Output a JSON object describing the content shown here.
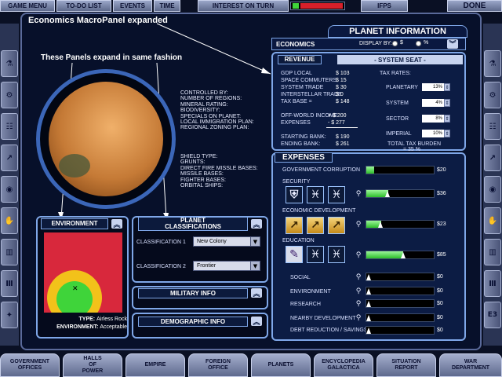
{
  "topbar": {
    "game_menu": "GAME MENU",
    "todo_list": "TO-DO LIST",
    "events": "EVENTS",
    "time": "TIME",
    "interest": "INTEREST ON TURN",
    "ifps": "IFPs",
    "done": "DONE"
  },
  "annotations": {
    "econ_expanded": "Economics MacroPanel expanded",
    "panels_expand": "These Panels expand in same fashion"
  },
  "planet_info": {
    "title": "PLANET INFORMATION",
    "economics_tab": "ECONOMICS",
    "display_by_label": "DISPLAY BY:",
    "display_dollar": "$",
    "display_percent": "%"
  },
  "planet_stats": {
    "controlled": "CONTROLLED BY:\nNUMBER OF REGIONS:\nMINERAL RATING:\nBIODIVERSITY:\nSPECIALS ON PLANET:\nLOCAL IMMIGRATION PLAN:\nREGIONAL ZONING PLAN:",
    "defense": "SHIELD TYPE:\nGRUNTS:\nDIRECT FIRE MISSLE BASES:\nMISSILE BASES:\nFIGHTER BASES:\nORBITAL SHIPS:"
  },
  "environment": {
    "title": "ENVIRONMENT",
    "type_label": "TYPE:",
    "type_value": "Airless Rock",
    "env_label": "ENVIRONMENT:",
    "env_value": "Acceptable"
  },
  "classifications": {
    "title": "PLANET\nCLASSIFICATIONS",
    "c1_label": "CLASSIFICATION 1",
    "c1_value": "New Colony",
    "c2_label": "CLASSIFICATION 2",
    "c2_value": "Frontier"
  },
  "military": {
    "title": "MILITARY INFO"
  },
  "demographic": {
    "title": "DEMOGRAPHIC INFO"
  },
  "revenue": {
    "title": "REVENUE",
    "system_seat": "- SYSTEM SEAT -",
    "gdp_label": "GDP LOCAL",
    "gdp_value": "$ 103",
    "commuters_label": "SPACE COMMUTERS",
    "commuters_value": "$ 15",
    "trade_label": "SYSTEM TRADE",
    "trade_value": "$ 30",
    "interstellar_label": "INTERSTELLAR TRADE",
    "interstellar_value": "$ 0",
    "taxbase_label": "TAX BASE =",
    "taxbase_value": "$ 148",
    "offworld_label": "OFF-WORLD INCOME",
    "offworld_value": "+ $ 200",
    "expenses_label": "EXPENSES",
    "expenses_value": "- $ 277",
    "starting_label": "STARTING BANK:",
    "starting_value": "$ 190",
    "ending_label": "ENDING BANK:",
    "ending_value": "$ 261",
    "tax_rates_label": "TAX RATES:",
    "planetary_label": "PLANETARY",
    "planetary_value": "13%",
    "system_label": "SYSTEM",
    "system_value": "4%",
    "sector_label": "SECTOR",
    "sector_value": "8%",
    "imperial_label": "IMPERIAL",
    "imperial_value": "10%",
    "burden_label": "TOTAL TAX BURDEN",
    "burden_value": "= 35 %"
  },
  "expenses": {
    "title": "EXPENSES",
    "rows": [
      {
        "label": "GOVERNMENT CORRUPTION",
        "value": "$20",
        "level": 0.12
      },
      {
        "label": "SECURITY",
        "value": "$36",
        "level": 0.32
      },
      {
        "label": "ECONOMIC DEVELOPMENT",
        "value": "$23",
        "level": 0.22
      },
      {
        "label": "EDUCATION",
        "value": "$85",
        "level": 0.55
      },
      {
        "label": "SOCIAL",
        "value": "$0",
        "level": 0
      },
      {
        "label": "ENVIRONMENT",
        "value": "$0",
        "level": 0
      },
      {
        "label": "RESEARCH",
        "value": "$0",
        "level": 0
      },
      {
        "label": "NEARBY DEVELOPMENT",
        "value": "$0",
        "level": 0
      },
      {
        "label": "DEBT REDUCTION / SAVINGS",
        "value": "$0",
        "level": 0
      }
    ]
  },
  "bottombar": {
    "government": "GOVERNMENT\nOFFICES",
    "halls": "HALLS\nOF\nPOWER",
    "empire": "EMPIRE",
    "foreign": "FOREIGN\nOFFICE",
    "planets": "PLANETS",
    "encyclopedia": "ENCYCLOPEDIA\nGALACTICA",
    "situation": "SITUATION\nREPORT",
    "war": "WAR\nDEPARTMENT"
  },
  "side_right_label": "E3",
  "colors": {
    "accent": "#7fa7e8",
    "env_bg": "#d8283c",
    "env_yellow": "#f2c21a",
    "env_green": "#3fd43a",
    "fill_green": "#2dbe2a"
  }
}
